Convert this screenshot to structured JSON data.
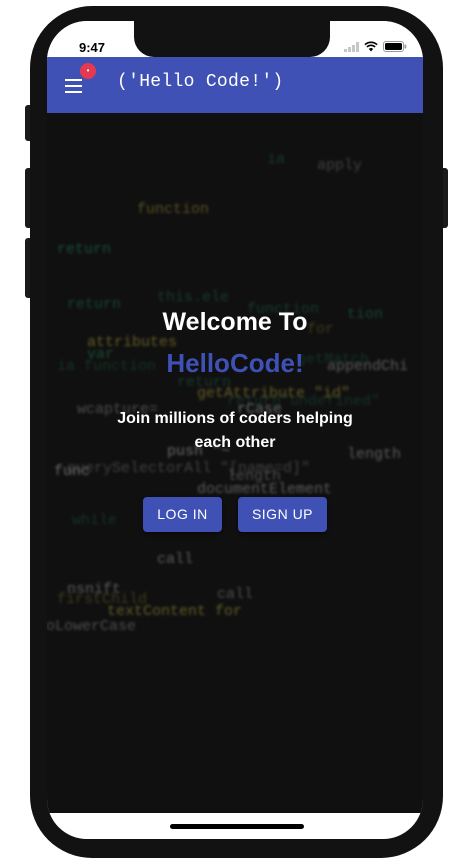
{
  "status_bar": {
    "time": "9:47"
  },
  "appbar": {
    "title": "('Hello Code!')",
    "badge": "•"
  },
  "hero": {
    "heading": "Welcome To",
    "brand": "HelloCode!",
    "tagline": "Join millions of coders helping each other"
  },
  "actions": {
    "login_label": "LOG IN",
    "signup_label": "SIGN UP"
  },
  "colors": {
    "primary": "#3f51b5",
    "badge": "#e53950",
    "code_green": "#2f9b6a",
    "code_yellow": "#c8b84a"
  },
  "background_code": [
    {
      "text": "apply",
      "color": "#cfcfcf"
    },
    {
      "text": "function",
      "color": "#2f9b6a"
    },
    {
      "text": "return",
      "color": "#2f9b6a"
    },
    {
      "text": "attributes",
      "color": "#c8b84a"
    },
    {
      "text": "ia function",
      "color": "#2f9b6a"
    },
    {
      "text": "return",
      "color": "#2f9b6a"
    },
    {
      "text": "appendChi",
      "color": "#cfcfcf"
    },
    {
      "text": "getAttribute \"id\"",
      "color": "#c8b84a"
    },
    {
      "text": "return\"undefined\"",
      "color": "#2f9b6a"
    },
    {
      "text": "wcapture=",
      "color": "#cfcfcf"
    },
    {
      "text": "length",
      "color": "#cfcfcf"
    },
    {
      "text": "push \"~",
      "color": "#cfcfcf"
    },
    {
      "text": "querySelectorAll \"[name=d]\"",
      "color": "#cfcfcf"
    },
    {
      "text": "length",
      "color": "#cfcfcf"
    },
    {
      "text": "documentElement",
      "color": "#cfcfcf"
    },
    {
      "text": "ia func",
      "color": "#cfcfcf"
    },
    {
      "text": "while",
      "color": "#2f9b6a"
    },
    {
      "text": "call",
      "color": "#cfcfcf"
    },
    {
      "text": "call",
      "color": "#cfcfcf"
    },
    {
      "text": "textContent  for",
      "color": "#c8b84a"
    },
    {
      "text": "firstChild",
      "color": "#c8b84a"
    },
    {
      "text": "toLowerCase",
      "color": "#cfcfcf"
    },
    {
      "text": "nsnift",
      "color": "#cfcfcf"
    },
    {
      "text": "rCase",
      "color": "#cfcfcf"
    },
    {
      "text": "getMatch",
      "color": "#2f9b6a"
    },
    {
      "text": "this.ele",
      "color": "#2f9b6a"
    },
    {
      "text": "tion",
      "color": "#2f9b6a"
    },
    {
      "text": "var",
      "color": "#2f9b6a"
    },
    {
      "text": "for",
      "color": "#c8b84a"
    },
    {
      "text": "ia",
      "color": "#2f9b6a"
    },
    {
      "text": "function",
      "color": "#c8b84a"
    },
    {
      "text": "return",
      "color": "#2f9b6a"
    }
  ]
}
